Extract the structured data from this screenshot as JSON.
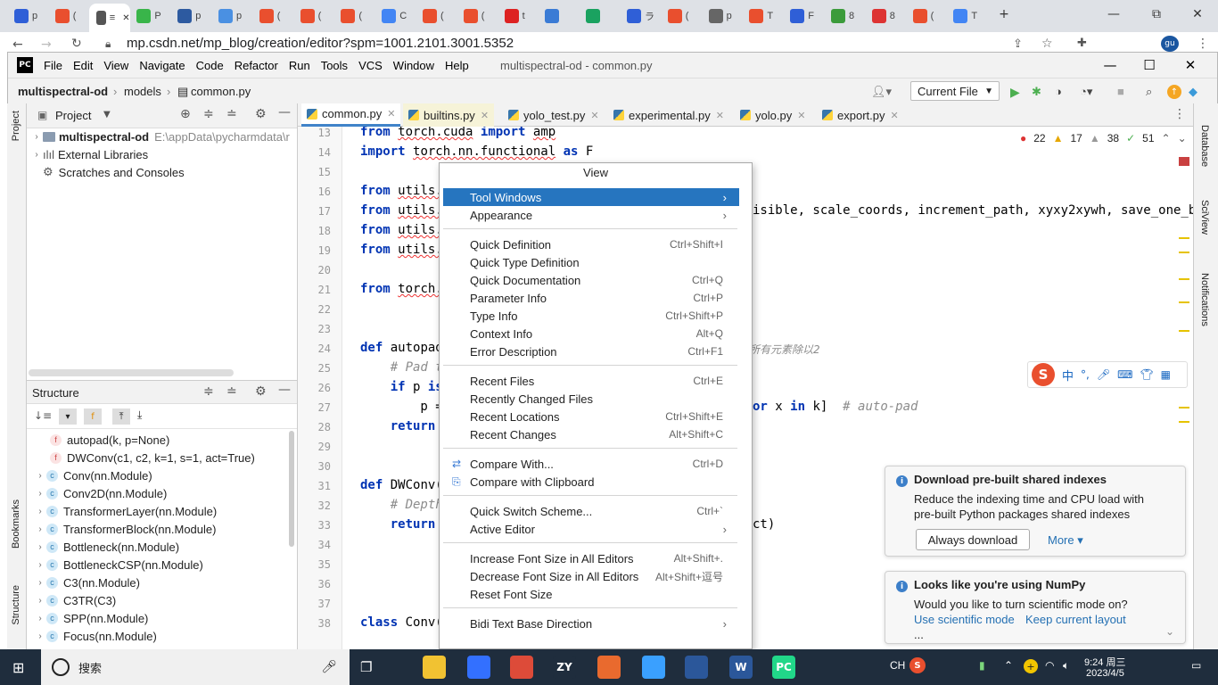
{
  "browser": {
    "tabs": [
      {
        "icon": "baidu-paw-icon",
        "label": "p",
        "color": "#2f5fd7"
      },
      {
        "icon": "csdn-icon",
        "label": "(",
        "color": "#e94f2e"
      },
      {
        "icon": "page-icon",
        "label": "≡",
        "color": "#555555"
      },
      {
        "icon": "leaf-icon",
        "label": "P",
        "color": "#39b54a"
      },
      {
        "icon": "ext-icon",
        "label": "p",
        "color": "#2d5aa0"
      },
      {
        "icon": "chrome-icon",
        "label": "p",
        "color": "#4a90e2"
      },
      {
        "icon": "csdn-icon",
        "label": "(",
        "color": "#e94f2e"
      },
      {
        "icon": "csdn-icon",
        "label": "(",
        "color": "#e94f2e"
      },
      {
        "icon": "csdn-icon",
        "label": "(",
        "color": "#e94f2e"
      },
      {
        "icon": "translate-icon",
        "label": "C",
        "color": "#4285f4"
      },
      {
        "icon": "csdn-icon",
        "label": "(",
        "color": "#e94f2e"
      },
      {
        "icon": "csdn-icon",
        "label": "(",
        "color": "#e94f2e"
      },
      {
        "icon": "51-icon",
        "label": "t",
        "color": "#d22"
      },
      {
        "icon": "ghost-icon",
        "label": "",
        "color": "#3a7bd5"
      },
      {
        "icon": "bookmark-icon",
        "label": "",
        "color": "#1aa260"
      },
      {
        "icon": "baidu-paw-icon",
        "label": "ラ",
        "color": "#2f5fd7"
      },
      {
        "icon": "csdn-icon",
        "label": "(",
        "color": "#e94f2e"
      },
      {
        "icon": "library-icon",
        "label": "p",
        "color": "#666666"
      },
      {
        "icon": "jian-icon",
        "label": "T",
        "color": "#e94f2e"
      },
      {
        "icon": "baidu-paw-icon",
        "label": "F",
        "color": "#2f5fd7"
      },
      {
        "icon": "green-icon",
        "label": "8",
        "color": "#3b9b3b"
      },
      {
        "icon": "iof-icon",
        "label": "8",
        "color": "#d33"
      },
      {
        "icon": "csdn-icon",
        "label": "(",
        "color": "#e94f2e"
      },
      {
        "icon": "google-icon",
        "label": "T",
        "color": "#4285f4"
      }
    ],
    "new_tab": "+",
    "url": "mp.csdn.net/mp_blog/creation/editor?spm=1001.2101.3001.5352",
    "window_controls": [
      "—",
      "⧉",
      "✕"
    ]
  },
  "ide": {
    "logo": "PC",
    "menu": [
      "File",
      "Edit",
      "View",
      "Navigate",
      "Code",
      "Refactor",
      "Run",
      "Tools",
      "VCS",
      "Window",
      "Help"
    ],
    "title": "multispectral-od - common.py",
    "breadcrumbs": [
      "multispectral-od",
      "models",
      "common.py"
    ],
    "run_config": "Current File",
    "project_panel": {
      "title": "Project",
      "rows": [
        {
          "label": "multispectral-od",
          "path": "E:\\appData\\pycharmdata\\r"
        },
        {
          "label": "External Libraries"
        },
        {
          "label": "Scratches and Consoles"
        }
      ]
    },
    "structure_panel": {
      "title": "Structure",
      "items": [
        {
          "kind": "f",
          "label": "autopad(k, p=None)"
        },
        {
          "kind": "f",
          "label": "DWConv(c1, c2, k=1, s=1, act=True)"
        },
        {
          "kind": "c",
          "label": "Conv(nn.Module)"
        },
        {
          "kind": "c",
          "label": "Conv2D(nn.Module)"
        },
        {
          "kind": "c",
          "label": "TransformerLayer(nn.Module)"
        },
        {
          "kind": "c",
          "label": "TransformerBlock(nn.Module)"
        },
        {
          "kind": "c",
          "label": "Bottleneck(nn.Module)"
        },
        {
          "kind": "c",
          "label": "BottleneckCSP(nn.Module)"
        },
        {
          "kind": "c",
          "label": "C3(nn.Module)"
        },
        {
          "kind": "c",
          "label": "C3TR(C3)"
        },
        {
          "kind": "c",
          "label": "SPP(nn.Module)"
        },
        {
          "kind": "c",
          "label": "Focus(nn.Module)"
        }
      ]
    },
    "left_strip": {
      "project": "Project",
      "bookmarks": "Bookmarks",
      "structure": "Structure"
    },
    "right_strip": {
      "database": "Database",
      "sciview": "SciView",
      "notifications": "Notifications"
    },
    "editor_tabs": [
      "common.py",
      "builtins.py",
      "yolo_test.py",
      "experimental.py",
      "yolo.py",
      "export.py"
    ],
    "inspections": {
      "errors": "22",
      "warnings": "17",
      "weak": "38",
      "typos": "51"
    },
    "line_numbers": [
      "13",
      "14",
      "15",
      "16",
      "17",
      "18",
      "19",
      "20",
      "21",
      "22",
      "23",
      "24",
      "25",
      "26",
      "27",
      "28",
      "29",
      "30",
      "31",
      "32",
      "33",
      "34",
      "35",
      "36",
      "37",
      "38"
    ],
    "code": {
      "l13": "from torch.cuda import amp",
      "l14": "import torch.nn.functional as F",
      "l16": "from utils.",
      "l17a": "from utils.",
      "l17b": "isible, scale_coords, increment_path, xyxy2xywh, save_one_box",
      "l18": "from utils.",
      "l19": "from utils.",
      "l21": "from torch.",
      "l24a": "def autopad",
      "l24b": "所有元素除以2",
      "l25": "    # Pad t",
      "l26": "    if p is",
      "l27a": "        p =",
      "l27b": "or x in k]  # auto-pad",
      "l28": "    return",
      "l31": "def DWConv(",
      "l32": "    # Depth",
      "l33a": "    return",
      "l33b": "ct)",
      "l38": "class Conv("
    },
    "context_menu": {
      "title": "View",
      "items": [
        {
          "label": "Tool Windows",
          "sub": "›",
          "selected": true
        },
        {
          "label": "Appearance",
          "sub": "›"
        },
        {
          "sep": true
        },
        {
          "label": "Quick Definition",
          "shortcut": "Ctrl+Shift+I"
        },
        {
          "label": "Quick Type Definition",
          "shortcut": ""
        },
        {
          "label": "Quick Documentation",
          "shortcut": "Ctrl+Q"
        },
        {
          "label": "Parameter Info",
          "shortcut": "Ctrl+P"
        },
        {
          "label": "Type Info",
          "shortcut": "Ctrl+Shift+P"
        },
        {
          "label": "Context Info",
          "shortcut": "Alt+Q"
        },
        {
          "label": "Error Description",
          "shortcut": "Ctrl+F1"
        },
        {
          "sep": true
        },
        {
          "label": "Recent Files",
          "shortcut": "Ctrl+E"
        },
        {
          "label": "Recently Changed Files",
          "shortcut": ""
        },
        {
          "label": "Recent Locations",
          "shortcut": "Ctrl+Shift+E"
        },
        {
          "label": "Recent Changes",
          "shortcut": "Alt+Shift+C"
        },
        {
          "sep": true
        },
        {
          "label": "Compare With...",
          "shortcut": "Ctrl+D",
          "icon": "compare-icon"
        },
        {
          "label": "Compare with Clipboard",
          "shortcut": "",
          "icon": "clipboard-compare-icon"
        },
        {
          "sep": true
        },
        {
          "label": "Quick Switch Scheme...",
          "shortcut": "Ctrl+`"
        },
        {
          "label": "Active Editor",
          "sub": "›"
        },
        {
          "sep": true
        },
        {
          "label": "Increase Font Size in All Editors",
          "shortcut": "Alt+Shift+."
        },
        {
          "label": "Decrease Font Size in All Editors",
          "shortcut": "Alt+Shift+逗号"
        },
        {
          "label": "Reset Font Size",
          "shortcut": ""
        },
        {
          "sep": true
        },
        {
          "label": "Bidi Text Base Direction",
          "sub": "›"
        }
      ]
    },
    "notifications": [
      {
        "title": "Download pre-built shared indexes",
        "body1": "Reduce the indexing time and CPU load with",
        "body2": "pre-built Python packages shared indexes",
        "button": "Always download",
        "more": "More ▾"
      },
      {
        "title": "Looks like you're using NumPy",
        "body1": "Would you like to turn scientific mode on?",
        "link1": "Use scientific mode",
        "link2": "Keep current layout",
        "ellipsis": "..."
      }
    ],
    "ime_toolbar": [
      "中",
      "°,"
    ]
  },
  "taskbar": {
    "search_placeholder": "搜索",
    "apps": [
      {
        "icon": "file-explorer-icon",
        "color": "#f1c232"
      },
      {
        "icon": "feishu-icon",
        "color": "#3370ff"
      },
      {
        "icon": "chrome-icon",
        "color": "#dd4b39"
      },
      {
        "icon": "zy-icon",
        "label": "ZY",
        "color": "#1f2d3d"
      },
      {
        "icon": "arrow-app-icon",
        "color": "#e96a2e"
      },
      {
        "icon": "baidu-netdisk-icon",
        "color": "#3aa0ff"
      },
      {
        "icon": "mail-icon",
        "color": "#2b579a"
      },
      {
        "icon": "word-icon",
        "label": "W",
        "color": "#2b579a"
      },
      {
        "icon": "pycharm-icon",
        "label": "PC",
        "color": "#21d789"
      }
    ],
    "tray": {
      "ime": "CH",
      "time": "9:24 周三",
      "date": "2023/4/5"
    }
  }
}
